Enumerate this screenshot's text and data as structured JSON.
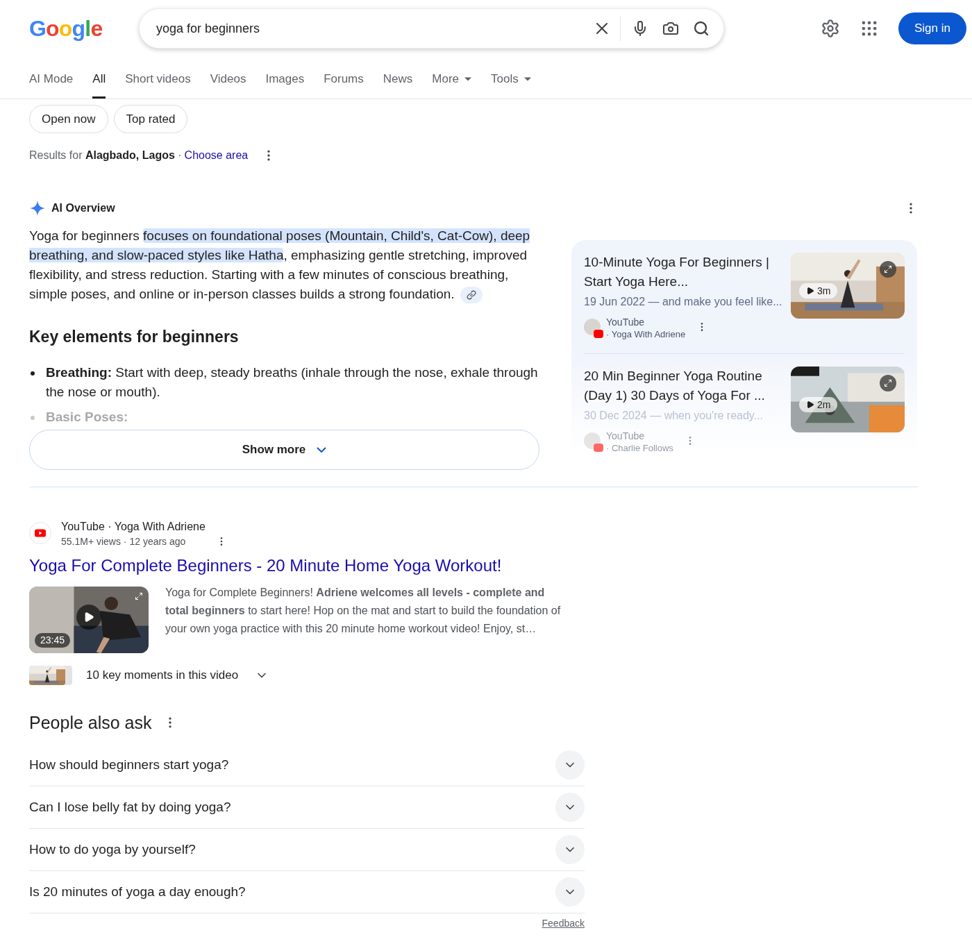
{
  "header": {
    "logo": "Google",
    "search": {
      "value": "yoga for beginners"
    },
    "sign_in": "Sign in"
  },
  "tabs": [
    {
      "label": "AI Mode",
      "selected": false,
      "kind": "link"
    },
    {
      "label": "All",
      "selected": true,
      "kind": "link"
    },
    {
      "label": "Short videos",
      "selected": false,
      "kind": "link"
    },
    {
      "label": "Videos",
      "selected": false,
      "kind": "link"
    },
    {
      "label": "Images",
      "selected": false,
      "kind": "link"
    },
    {
      "label": "Forums",
      "selected": false,
      "kind": "link"
    },
    {
      "label": "News",
      "selected": false,
      "kind": "link"
    },
    {
      "label": "More",
      "selected": false,
      "kind": "menu"
    },
    {
      "label": "Tools",
      "selected": false,
      "kind": "menu"
    }
  ],
  "chips": [
    "Open now",
    "Top rated"
  ],
  "location": {
    "text": "Results for **Alagbado, Lagos** ·",
    "link": "Choose area"
  },
  "ai_overview": {
    "title": "AI Overview",
    "paragraph": [
      {
        "text": "Yoga for beginners ",
        "highlighted": false
      },
      {
        "text": "focuses on foundational poses (Mountain, Child's, Cat-Cow), deep breathing, and slow-paced styles like Hatha",
        "highlighted": true
      },
      {
        "text": ", emphasizing gentle stretching, improved flexibility, and stress reduction. Starting with a few minutes of conscious breathing, simple poses, and online or in-person classes builds a strong foundation.",
        "highlighted": false
      }
    ],
    "heading": "Key elements for beginners",
    "bullets": [
      {
        "text": "**Breathing:** Start with deep, steady breaths (inhale through the nose, exhale through the nose or mouth).",
        "faded": false
      },
      {
        "text": "**Basic Poses:**",
        "faded": true
      }
    ],
    "show_more": "Show more",
    "videos": [
      {
        "title": "10-Minute Yoga For Beginners | Start Yoga Here...",
        "snippet": "19 Jun 2022 — and make you feel like...",
        "source": "YouTube",
        "channel": "· Yoga With Adriene",
        "duration": "3m",
        "faded": false
      },
      {
        "title": "20 Min Beginner Yoga Routine (Day 1) 30 Days of Yoga For ...",
        "snippet": "30 Dec 2024 — when you're ready...",
        "source": "YouTube",
        "channel": "· Charlie Follows",
        "duration": "2m",
        "faded": true
      }
    ]
  },
  "result": {
    "source": "YouTube · Yoga With Adriene",
    "meta": "55.1M+ views · 12 years ago",
    "title": "Yoga For Complete Beginners - 20 Minute Home Yoga Workout!",
    "snippet": "Yoga for Complete Beginners! **Adriene welcomes all levels - complete and total beginners** to start here! Hop on the mat and start to build the foundation of your own yoga practice with this 20 minute home workout video! Enjoy, st…",
    "duration": "23:45",
    "key_moments": "10 key moments in this video"
  },
  "people_also_ask": {
    "title": "People also ask",
    "questions": [
      "How should beginners start yoga?",
      "Can I lose belly fat by doing yoga?",
      "How to do yoga by yourself?",
      "Is 20 minutes of yoga a day enough?"
    ],
    "feedback": "Feedback"
  }
}
